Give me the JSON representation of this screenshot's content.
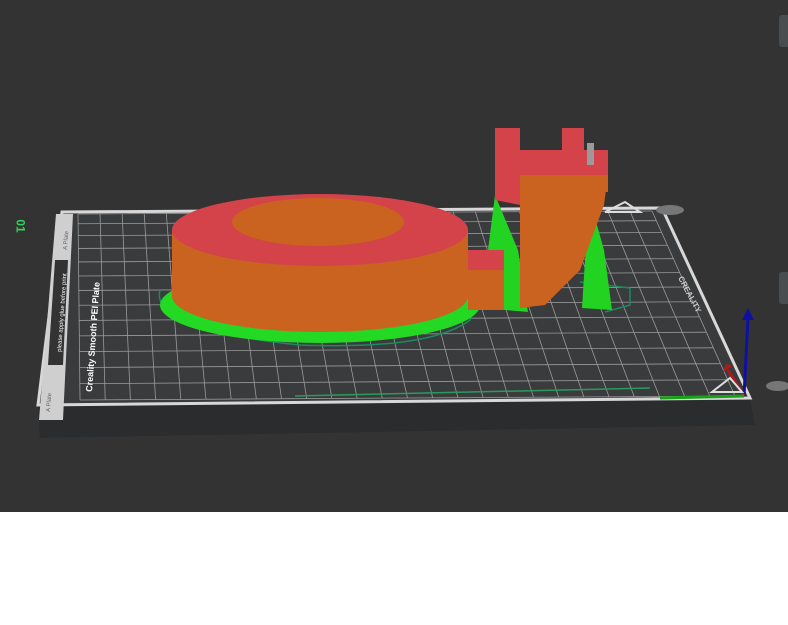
{
  "viewport": {
    "plate_number": "01",
    "plate_name": "Creality Smooth PEI Plate",
    "plate_side_label": "A Plate",
    "plate_notice": "please apply glue before print",
    "brand_label": "CREALITY"
  },
  "colors": {
    "background": "#333334",
    "model_top": "#d9434a",
    "model_side": "#c8621e",
    "support": "#1ed41e",
    "axis_x": "#b01818",
    "axis_y": "#16a316",
    "axis_z": "#1010a0"
  }
}
